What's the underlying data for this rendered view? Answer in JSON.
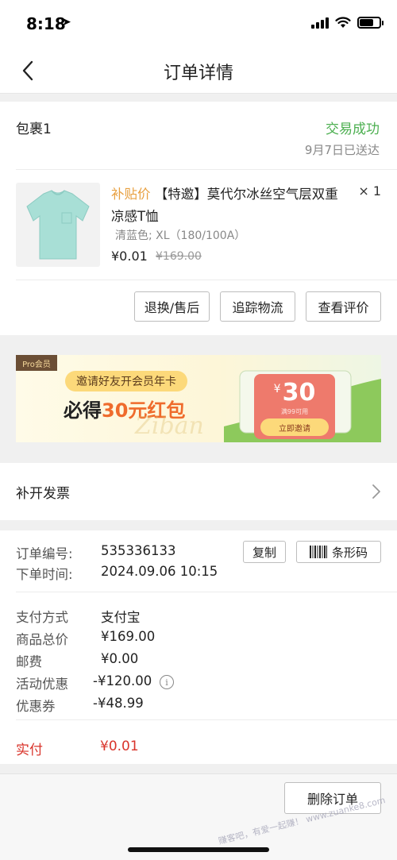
{
  "status_bar": {
    "time": "8:18",
    "location_arrow": "➤"
  },
  "nav": {
    "title": "订单详情",
    "back_icon": "chevron-left-icon"
  },
  "package": {
    "title": "包裹1",
    "status": "交易成功",
    "delivered": "9月7日已送达",
    "product": {
      "tag": "补贴价",
      "name_rest": "【特邀】莫代尔冰丝空气层双重凉感T恤",
      "quantity": "× 1",
      "spec": "清蓝色; XL（180/100A）",
      "price": "¥0.01",
      "original_price": "¥169.00",
      "image_color": "#a8dfd6"
    },
    "actions": {
      "return": "退换/售后",
      "track": "追踪物流",
      "review": "查看评价"
    }
  },
  "banner": {
    "badge": "Pro会员",
    "invite": "邀请好友开会员年卡",
    "main_prefix": "必得",
    "main_amount": "30元红包",
    "script_text": "Ziban",
    "coupon": {
      "currency": "¥",
      "amount": "30",
      "condition": "满99可用",
      "button": "立即邀请"
    }
  },
  "invoice": {
    "label": "补开发票"
  },
  "order": {
    "number_label": "订单编号:",
    "number_value": "535336133",
    "time_label": "下单时间:",
    "time_value": "2024.09.06 10:15",
    "copy": "复制",
    "barcode": "条形码",
    "payment_method_label": "支付方式",
    "payment_method_value": "支付宝",
    "total_label": "商品总价",
    "total_value": "¥169.00",
    "shipping_label": "邮费",
    "shipping_value": "¥0.00",
    "promo_label": "活动优惠",
    "promo_value": "-¥120.00",
    "coupon_label": "优惠券",
    "coupon_value": "-¥48.99",
    "paid_label": "实付",
    "paid_value": "¥0.01"
  },
  "bottom": {
    "delete": "删除订单",
    "watermark": "赚客吧，有爱一起赚！ www.zuanke8.com"
  },
  "colors": {
    "success": "#4caf50",
    "price_red": "#d9342b",
    "tag_orange": "#e8a040",
    "coupon_red": "#ee7a6c"
  }
}
